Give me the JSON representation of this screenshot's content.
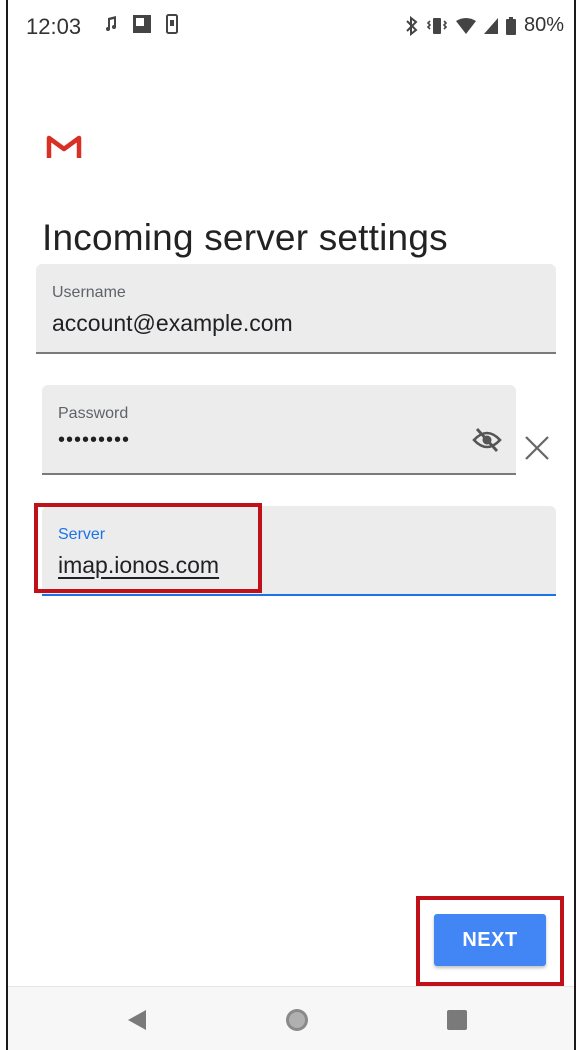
{
  "status_bar": {
    "time": "12:03",
    "battery_percent": "80%",
    "left_icons": [
      "music-note-icon",
      "image-icon",
      "phone-icon"
    ],
    "right_icons": [
      "bluetooth-icon",
      "vibrate-icon",
      "wifi-icon",
      "signal-icon",
      "battery-icon"
    ]
  },
  "app": {
    "logo": "gmail-logo",
    "title": "Incoming server settings"
  },
  "fields": {
    "username": {
      "label": "Username",
      "value": "account@example.com"
    },
    "password": {
      "label": "Password",
      "value": "•••••••••"
    },
    "server": {
      "label": "Server",
      "value": "imap.ionos.com"
    }
  },
  "actions": {
    "next_label": "NEXT"
  },
  "colors": {
    "accent": "#1a73e8",
    "button": "#4285f4",
    "highlight": "#c0101a",
    "gmail_red": "#d93025"
  },
  "navigation": {
    "buttons": [
      "back-icon",
      "home-icon",
      "recents-icon"
    ]
  }
}
